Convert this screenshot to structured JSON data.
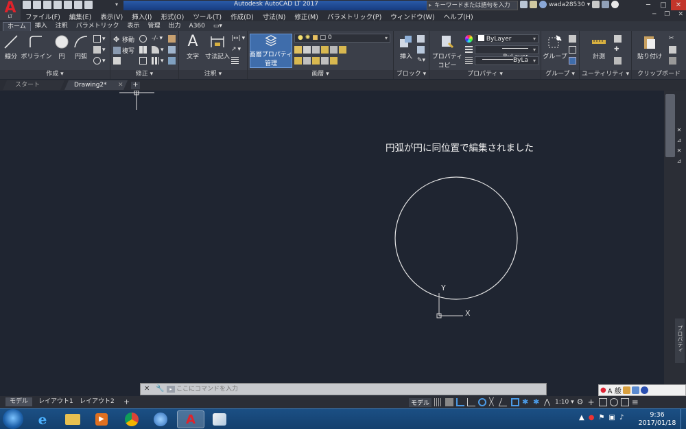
{
  "window": {
    "title": "Autodesk AutoCAD LT 2017",
    "search_placeholder": "キーワードまたは語句を入力",
    "user": "wada28530",
    "app_logo_letter": "A",
    "app_logo_sub": "LT"
  },
  "menu": [
    "ファイル(F)",
    "編集(E)",
    "表示(V)",
    "挿入(I)",
    "形式(O)",
    "ツール(T)",
    "作成(D)",
    "寸法(N)",
    "修正(M)",
    "パラメトリック(P)",
    "ウィンドウ(W)",
    "ヘルプ(H)"
  ],
  "ribbon_tabs": [
    "ホーム",
    "挿入",
    "注釈",
    "パラメトリック",
    "表示",
    "管理",
    "出力",
    "A360"
  ],
  "ribbon": {
    "draw": {
      "title": "作成 ▾",
      "line": "線分",
      "polyline": "ポリライン",
      "circle": "円",
      "arc": "円弧"
    },
    "modify": {
      "title": "修正 ▾",
      "move": "移動",
      "copy": "複写"
    },
    "annotation": {
      "title": "注釈 ▾",
      "text": "文字",
      "dimension": "寸法記入"
    },
    "layers": {
      "title": "画層 ▾",
      "layer_props_line1": "画層プロパティ",
      "layer_props_line2": "管理",
      "current_layer": "0"
    },
    "block": {
      "title": "ブロック ▾",
      "insert": "挿入"
    },
    "properties": {
      "title": "プロパティ ▾",
      "match_line1": "プロパティ",
      "match_line2": "コピー",
      "color": "ByLayer",
      "linetype": "ByLayer",
      "lineweight": "ByLa"
    },
    "groups": {
      "title": "グループ ▾",
      "group": "グループ"
    },
    "utilities": {
      "title": "ユーティリティ ▾",
      "measure": "計測"
    },
    "clipboard": {
      "title": "クリップボード",
      "paste": "貼り付け"
    }
  },
  "doc_tabs": {
    "start": "スタート",
    "drawing": "Drawing2*"
  },
  "canvas": {
    "message": "円弧が円に同位置で編集されました",
    "ucs_y": "Y",
    "ucs_x": "X"
  },
  "side_palette": {
    "properties_label": "プロパティ"
  },
  "command_line": {
    "placeholder": "ここにコマンドを入力"
  },
  "ime": {
    "mode": "A 般"
  },
  "layout_tabs": [
    "モデル",
    "レイアウト1",
    "レイアウト2"
  ],
  "status_bar": {
    "model": "モデル",
    "scale": "1:10 ▾"
  },
  "taskbar": {
    "time": "9:36",
    "date": "2017/01/18"
  },
  "colors": {
    "canvas_bg": "#1f2531",
    "ribbon_bg": "#3b3f49",
    "accent_blue": "#2a5aa8",
    "autocad_red": "#e0232b"
  }
}
